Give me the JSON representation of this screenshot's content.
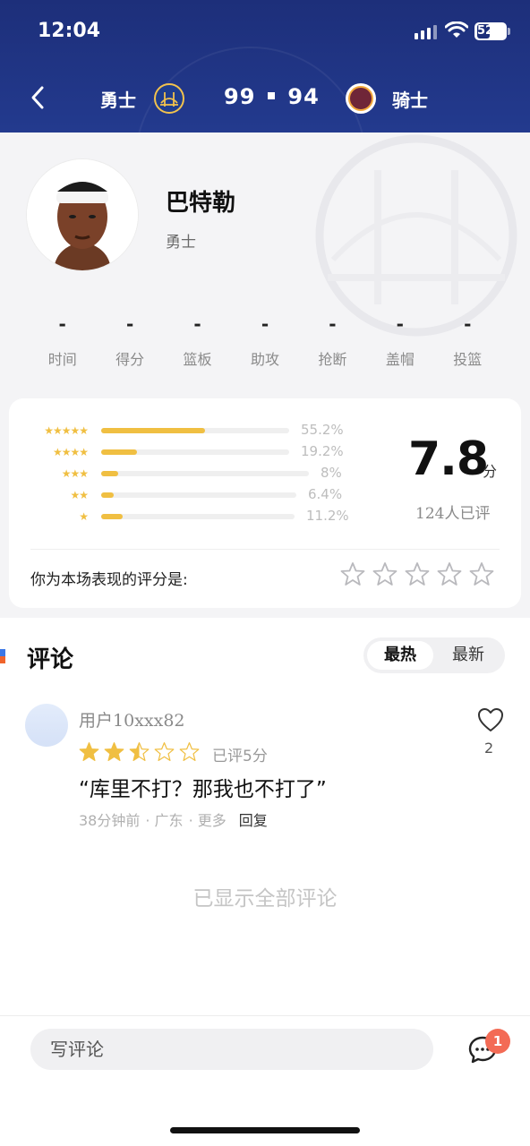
{
  "status_bar": {
    "time": "12:04",
    "battery": "52"
  },
  "header": {
    "home_team": "勇士",
    "away_team": "骑士",
    "home_score": "99",
    "away_score": "94",
    "home_logo_icon": "warriors-logo-icon",
    "away_logo_icon": "cavaliers-logo-icon"
  },
  "player": {
    "name": "巴特勒",
    "team": "勇士",
    "stats": [
      {
        "label": "时间",
        "value": "-"
      },
      {
        "label": "得分",
        "value": "-"
      },
      {
        "label": "篮板",
        "value": "-"
      },
      {
        "label": "助攻",
        "value": "-"
      },
      {
        "label": "抢断",
        "value": "-"
      },
      {
        "label": "盖帽",
        "value": "-"
      },
      {
        "label": "投篮",
        "value": "-"
      }
    ]
  },
  "rating": {
    "distribution": [
      {
        "stars": "★★★★★",
        "percent": 55.2,
        "label": "55.2%"
      },
      {
        "stars": "★★★★",
        "percent": 19.2,
        "label": "19.2%"
      },
      {
        "stars": "★★★",
        "percent": 8,
        "label": "8%"
      },
      {
        "stars": "★★",
        "percent": 6.4,
        "label": "6.4%"
      },
      {
        "stars": "★",
        "percent": 11.2,
        "label": "11.2%"
      }
    ],
    "score": "7.8",
    "score_unit": "分",
    "raters": "124人已评",
    "your_rating_label": "你为本场表现的评分是:"
  },
  "comments": {
    "title": "评论",
    "sort_options": [
      "最热",
      "最新"
    ],
    "items": [
      {
        "user": "用户10xxx82",
        "stars": 2.5,
        "rated": "已评5分",
        "text": "“库里不打？那我也不打了”",
        "time": "38分钟前",
        "location": "· 广东",
        "more": "· 更多",
        "reply": "回复",
        "likes": "2"
      }
    ],
    "all_shown": "已显示全部评论"
  },
  "composer": {
    "placeholder": "写评论",
    "badge": "1"
  },
  "colors": {
    "header": "#1d2f7a",
    "star": "#f0bf42",
    "badge": "#f36b55"
  }
}
